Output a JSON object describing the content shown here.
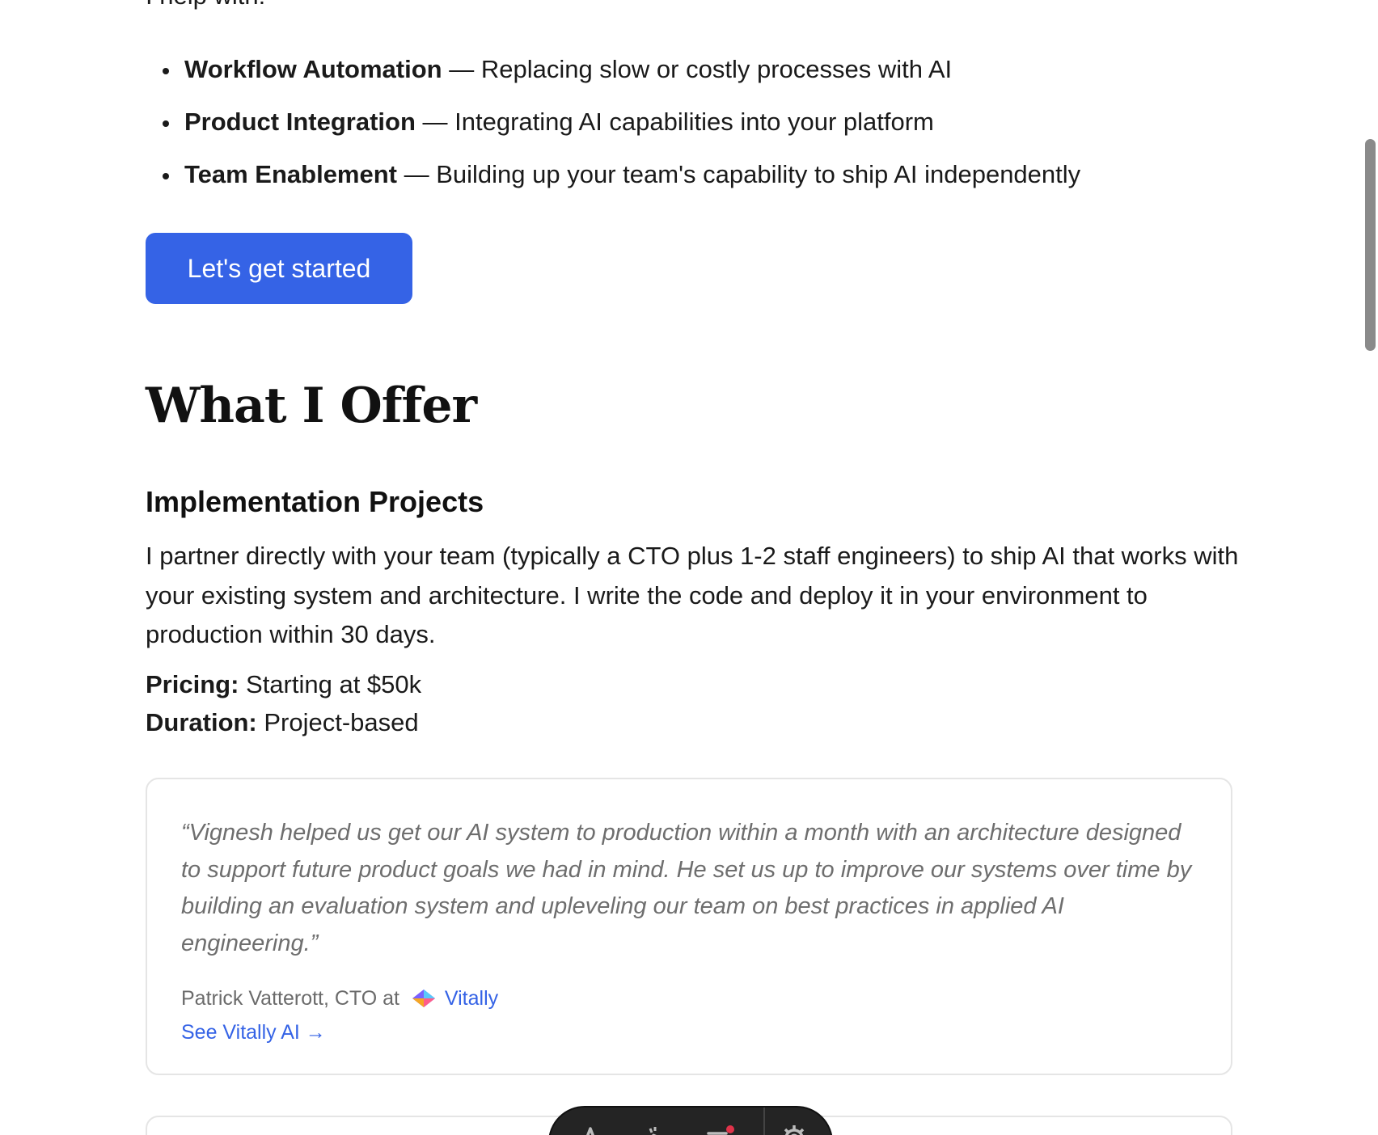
{
  "intro": {
    "cut_text": "I help with:"
  },
  "help_list": [
    {
      "title": "Workflow Automation",
      "desc": " — Replacing slow or costly processes with AI"
    },
    {
      "title": "Product Integration",
      "desc": " — Integrating AI capabilities into your platform"
    },
    {
      "title": "Team Enablement",
      "desc": " — Building up your team's capability to ship AI independently"
    }
  ],
  "cta": {
    "label": "Let's get started"
  },
  "offer": {
    "heading": "What I Offer",
    "implementation": {
      "heading": "Implementation Projects",
      "description": "I partner directly with your team (typically a CTO plus 1-2 staff engineers) to ship AI that works with your existing system and architecture. I write the code and deploy it in your environment to production within 30 days.",
      "pricing_label": "Pricing:",
      "pricing_value": " Starting at $50k",
      "duration_label": "Duration:",
      "duration_value": " Project-based"
    }
  },
  "testimonial": {
    "quote": "“Vignesh helped us get our AI system to production within a month with an architecture designed to support future product goals we had in mind. He set us up to improve our systems over time by building an evaluation system and upleveling our team on best practices in applied AI engineering.”",
    "author": "Patrick Vatterott, CTO at",
    "company": "Vitally",
    "company_logo_icon": "vitally-logo-icon",
    "link": "See Vitally AI →"
  },
  "toolbar": {
    "icons": [
      "text-icon",
      "pointer-icon",
      "menu-icon",
      "gear-icon"
    ],
    "notification_color": "#e0334a"
  },
  "colors": {
    "accent": "#3563e6",
    "text": "#1a1a1a",
    "muted": "#6e6e6e",
    "border": "#e5e5e5"
  }
}
